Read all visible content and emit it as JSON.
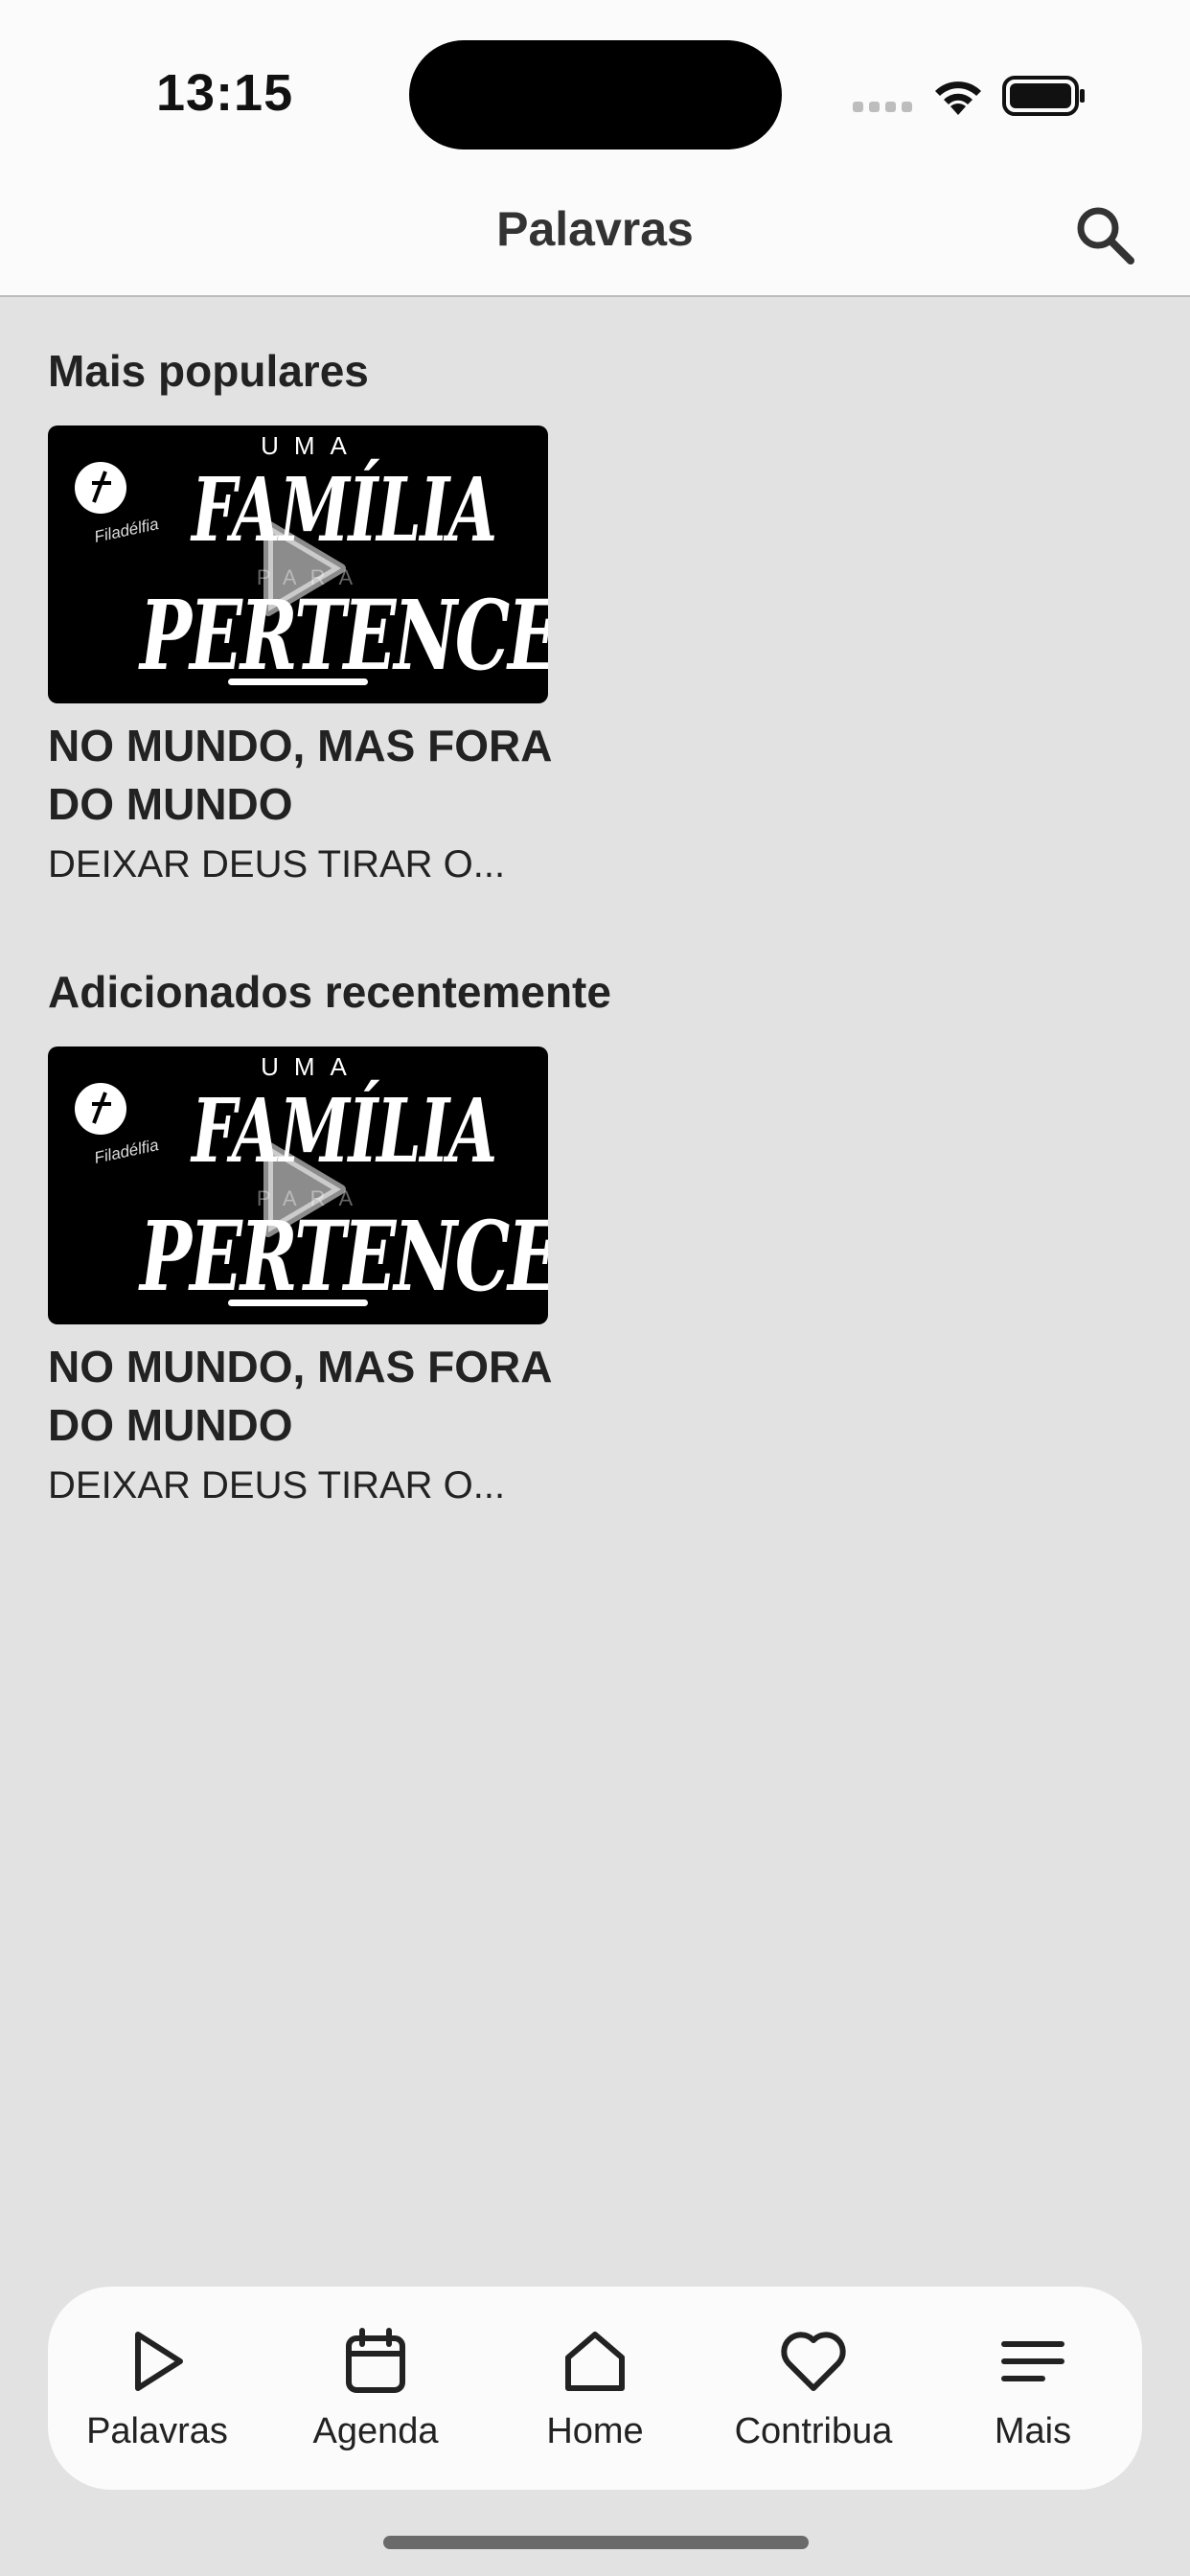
{
  "status_bar": {
    "time": "13:15",
    "icons": [
      "signal-dots-icon",
      "wifi-icon",
      "battery-icon"
    ]
  },
  "nav": {
    "title": "Palavras",
    "search_icon": "search-icon"
  },
  "sections": [
    {
      "title": "Mais populares",
      "item": {
        "thumb_text_top": "UMA",
        "thumb_text_main": "FAMÍLIA",
        "thumb_text_mid": "PARA",
        "thumb_text_bottom": "PERTENCER",
        "thumb_brand": "Filadélfia",
        "title": "NO MUNDO, MAS FORA DO MUNDO",
        "subtitle": "DEIXAR DEUS TIRAR O..."
      }
    },
    {
      "title": "Adicionados recentemente",
      "item": {
        "thumb_text_top": "UMA",
        "thumb_text_main": "FAMÍLIA",
        "thumb_text_mid": "PARA",
        "thumb_text_bottom": "PERTENCER",
        "thumb_brand": "Filadélfia",
        "title": "NO MUNDO, MAS FORA DO MUNDO",
        "subtitle": "DEIXAR DEUS TIRAR O..."
      }
    }
  ],
  "tabs": [
    {
      "label": "Palavras",
      "icon": "play-icon"
    },
    {
      "label": "Agenda",
      "icon": "calendar-icon"
    },
    {
      "label": "Home",
      "icon": "home-icon"
    },
    {
      "label": "Contribua",
      "icon": "heart-icon"
    },
    {
      "label": "Mais",
      "icon": "menu-icon"
    }
  ],
  "colors": {
    "background": "#e2e2e2",
    "bar_background": "#fbfbfb",
    "text": "#222222"
  }
}
